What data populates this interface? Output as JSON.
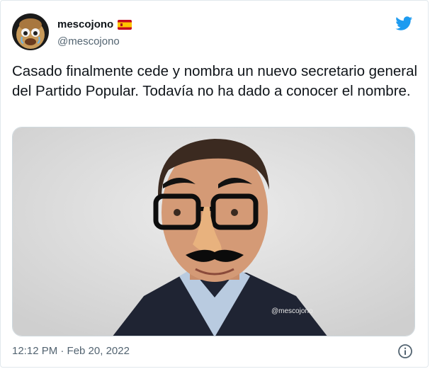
{
  "tweet": {
    "author_name": "mescojono",
    "author_handle": "@mescojono",
    "text": "Casado finalmente cede y nombra un nuevo secretario general del Partido Popular. Todavía no ha dado a conocer el nombre.",
    "timestamp": "12:12 PM · Feb 20, 2022",
    "watermark": "@mescojono"
  },
  "icons": {
    "brand": "twitter-bird-icon",
    "flag": "spain-flag-icon",
    "info": "info-icon"
  },
  "colors": {
    "brand_blue": "#1d9bf0",
    "text_primary": "#0f1419",
    "text_secondary": "#536471"
  }
}
